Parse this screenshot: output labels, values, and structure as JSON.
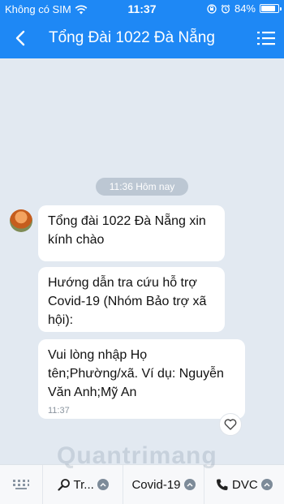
{
  "status_bar": {
    "carrier": "Không có SIM",
    "time": "11:37",
    "battery": "84%",
    "battery_level": 0.84
  },
  "header": {
    "title": "Tổng Đài 1022 Đà Nẵng",
    "back_icon": "chevron-left-icon",
    "menu_icon": "list-menu-icon"
  },
  "chat": {
    "date_label": "11:36 Hôm nay",
    "messages": [
      {
        "text": "Tổng đài 1022 Đà Nẵng xin kính chào"
      },
      {
        "text": "Hướng dẫn tra cứu hỗ trợ Covid-19 (Nhóm Bảo trợ xã hội):"
      },
      {
        "text": "Vui lòng nhập Họ tên;Phường/xã. Ví dụ: Nguyễn Văn Anh;Mỹ An",
        "time": "11:37"
      }
    ]
  },
  "bottom_bar": {
    "items": [
      {
        "label": "Tr...",
        "icon": "search-icon"
      },
      {
        "label": "Covid-19"
      },
      {
        "label": "DVC",
        "icon": "phone-icon"
      }
    ]
  },
  "watermark": "Quantrimang"
}
